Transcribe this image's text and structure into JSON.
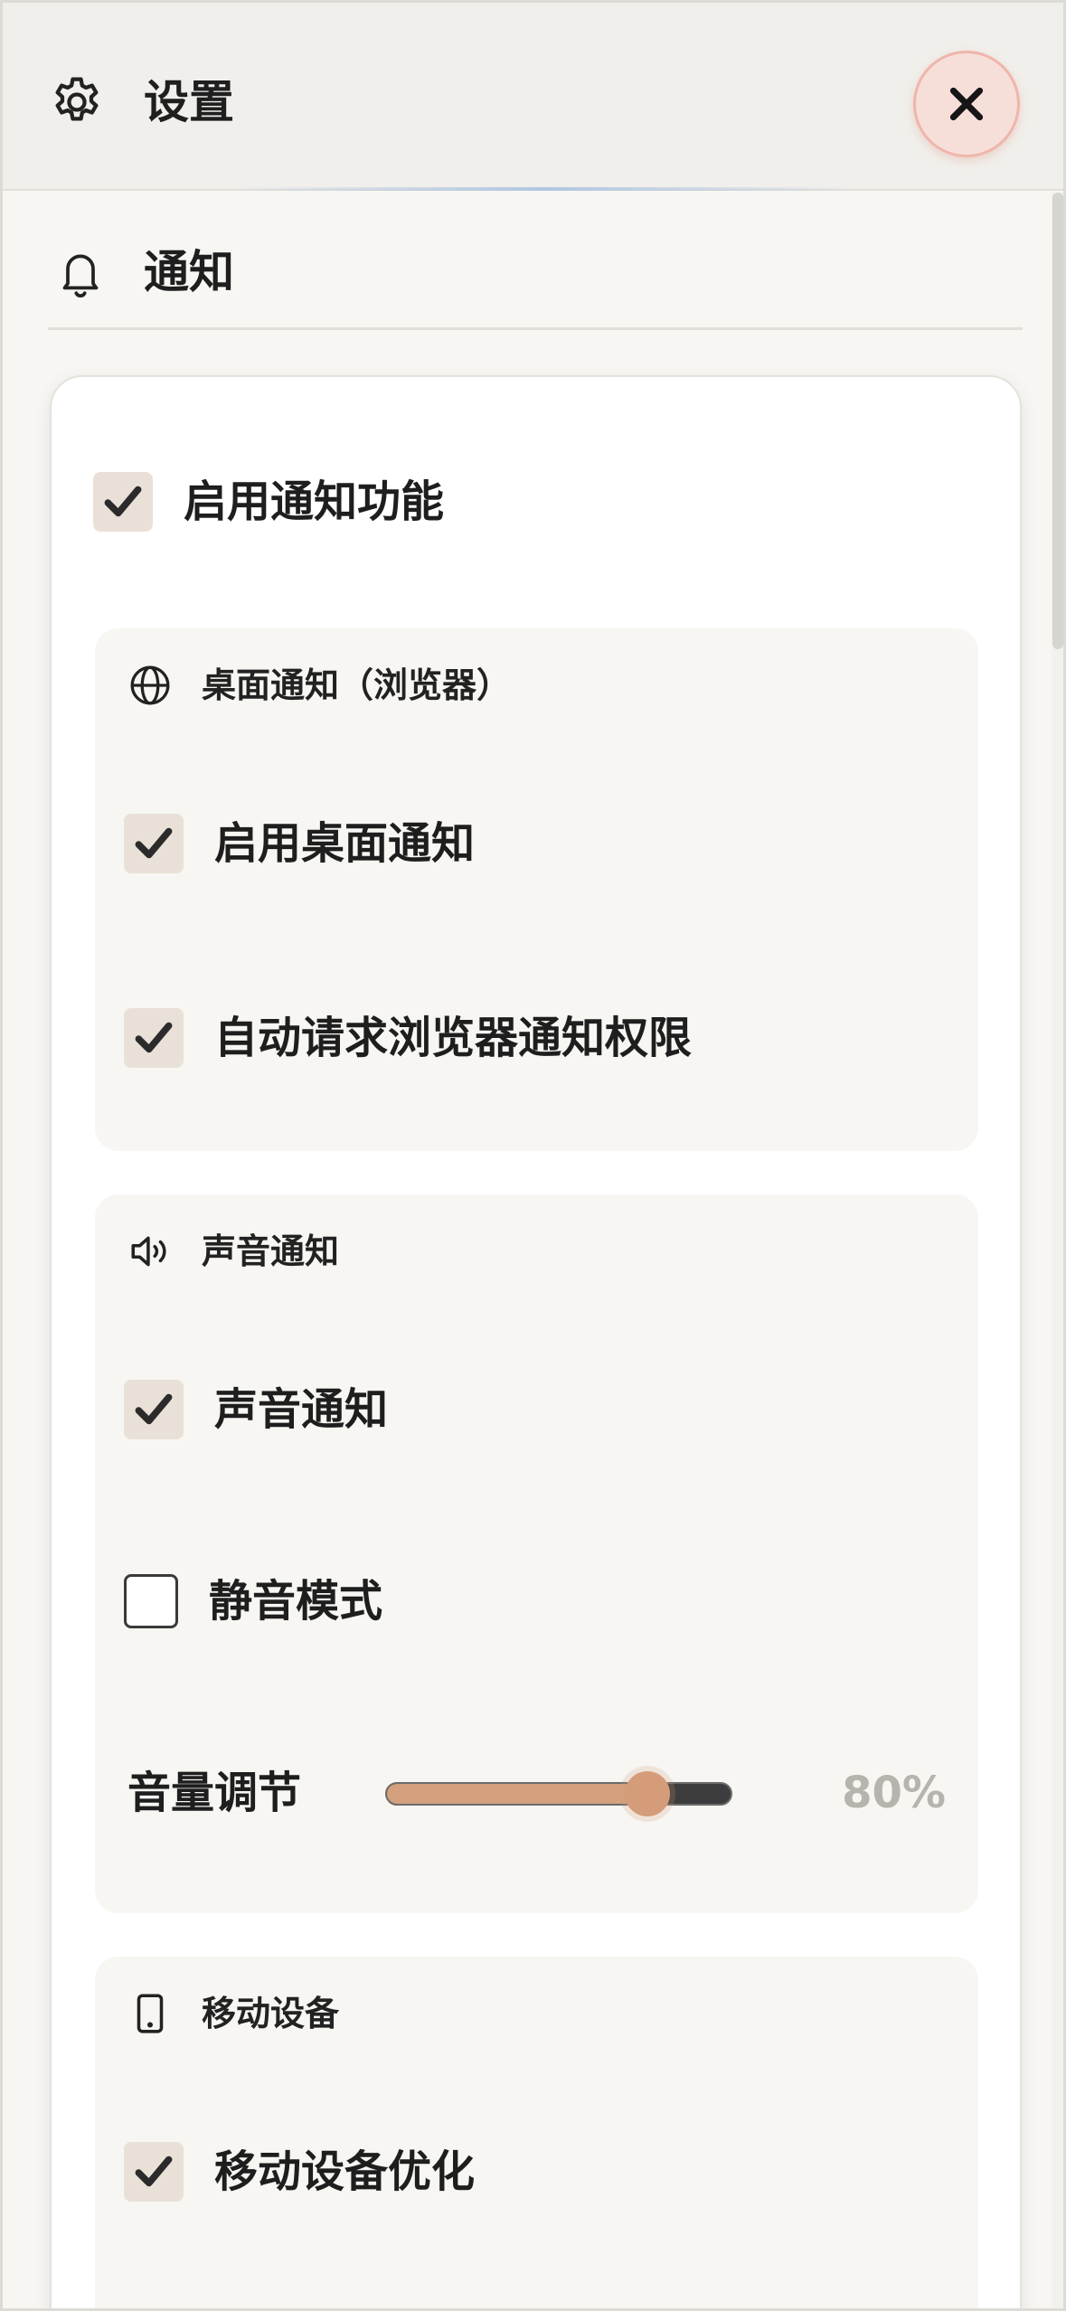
{
  "header": {
    "title": "设置",
    "gear_icon": "gear-icon",
    "close_icon": "close-icon"
  },
  "section": {
    "title": "通知",
    "icon": "bell-icon"
  },
  "main_toggle": {
    "label": "启用通知功能",
    "checked": true
  },
  "groups": [
    {
      "title": "桌面通知（浏览器）",
      "icon": "globe-icon",
      "items": [
        {
          "label": "启用桌面通知",
          "checked": true
        },
        {
          "label": "自动请求浏览器通知权限",
          "checked": true
        }
      ]
    },
    {
      "title": "声音通知",
      "icon": "speaker-icon",
      "items": [
        {
          "label": "声音通知",
          "checked": true
        },
        {
          "label": "静音模式",
          "checked": false
        }
      ],
      "volume": {
        "label": "音量调节",
        "value": 80,
        "display": "80%"
      }
    },
    {
      "title": "移动设备",
      "icon": "phone-icon",
      "items": [
        {
          "label": "移动设备优化",
          "checked": true
        }
      ]
    }
  ],
  "colors": {
    "accent": "#d49c78",
    "checkbox_bg": "#e9e1d7",
    "close_bg": "#f7dfd9"
  }
}
